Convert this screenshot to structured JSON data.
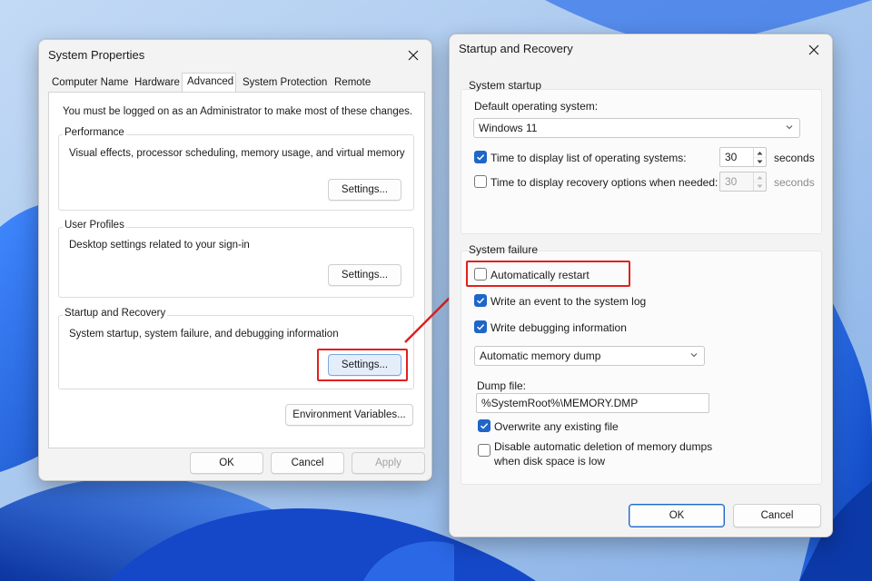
{
  "colors": {
    "accent": "#1e66c8",
    "highlight_red": "#e12020",
    "window_bg": "#f3f3f3",
    "wallpaper_blue": "#1f5fe0"
  },
  "system_properties": {
    "title": "System Properties",
    "tabs": [
      {
        "label": "Computer Name"
      },
      {
        "label": "Hardware"
      },
      {
        "label": "Advanced"
      },
      {
        "label": "System Protection"
      },
      {
        "label": "Remote"
      }
    ],
    "active_tab": "Advanced",
    "admin_notice": "You must be logged on as an Administrator to make most of these changes.",
    "performance": {
      "title": "Performance",
      "description": "Visual effects, processor scheduling, memory usage, and virtual memory",
      "settings_label": "Settings..."
    },
    "user_profiles": {
      "title": "User Profiles",
      "description": "Desktop settings related to your sign-in",
      "settings_label": "Settings..."
    },
    "startup_recovery": {
      "title": "Startup and Recovery",
      "description": "System startup, system failure, and debugging information",
      "settings_label": "Settings..."
    },
    "env_vars_label": "Environment Variables...",
    "ok_label": "OK",
    "cancel_label": "Cancel",
    "apply_label": "Apply"
  },
  "startup_recovery_dialog": {
    "title": "Startup and Recovery",
    "system_startup": {
      "heading": "System startup",
      "default_os_label": "Default operating system:",
      "default_os_value": "Windows 11",
      "time_display_os_label": "Time to display list of operating systems:",
      "time_display_os_checked": true,
      "time_display_os_value": "30",
      "time_display_recovery_label": "Time to display recovery options when needed:",
      "time_display_recovery_checked": false,
      "time_display_recovery_value": "30",
      "seconds_label": "seconds"
    },
    "system_failure": {
      "heading": "System failure",
      "auto_restart_label": "Automatically restart",
      "auto_restart_checked": false,
      "write_event_label": "Write an event to the system log",
      "write_event_checked": true,
      "write_debug_label": "Write debugging information",
      "write_debug_checked": true,
      "dump_type_value": "Automatic memory dump",
      "dump_file_label": "Dump file:",
      "dump_file_value": "%SystemRoot%\\MEMORY.DMP",
      "overwrite_label": "Overwrite any existing file",
      "overwrite_checked": true,
      "disable_delete_label_line1": "Disable automatic deletion of memory dumps",
      "disable_delete_label_line2": "when disk space is low",
      "disable_delete_checked": false
    },
    "ok_label": "OK",
    "cancel_label": "Cancel"
  }
}
